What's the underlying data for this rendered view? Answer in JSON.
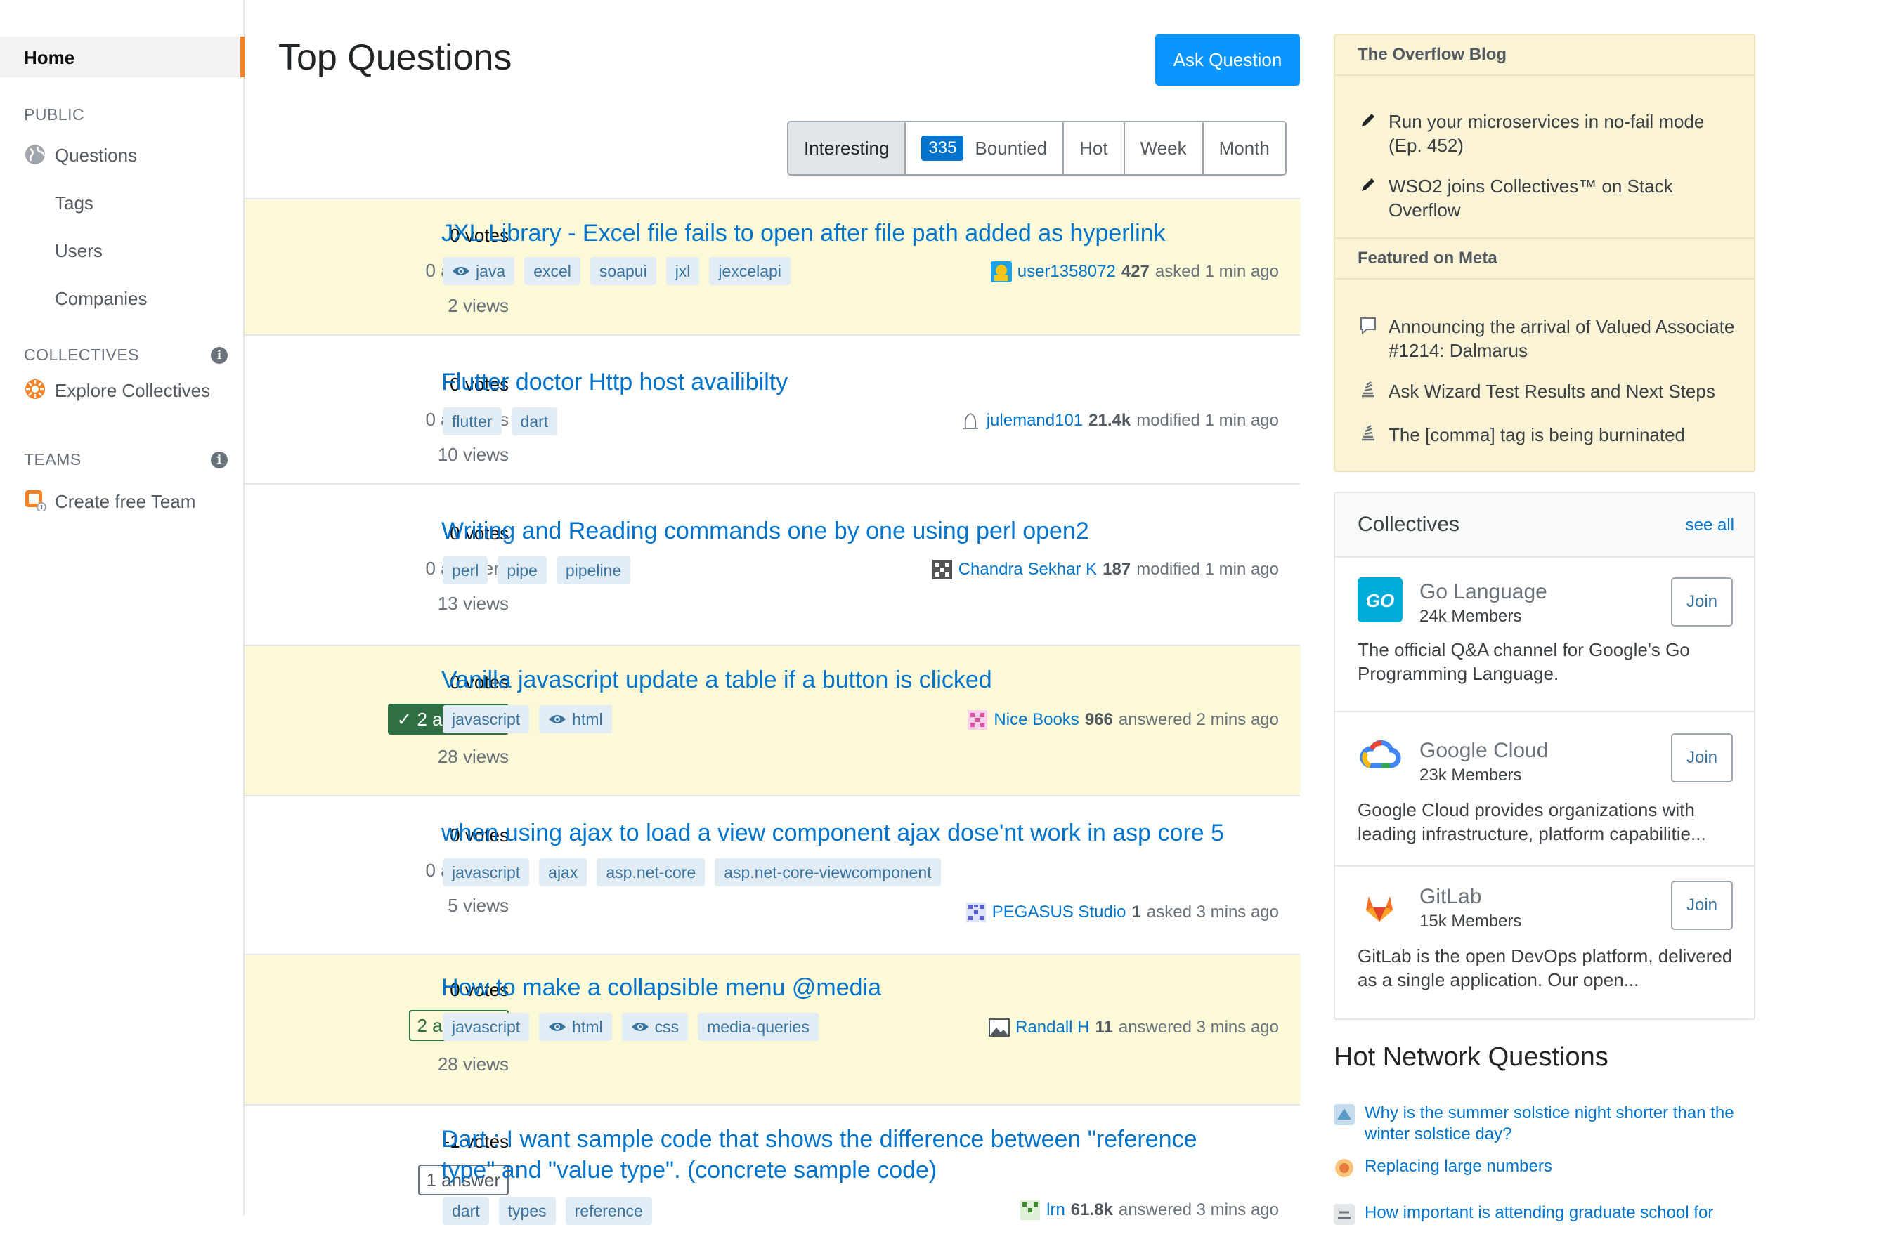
{
  "sidebar": {
    "home": "Home",
    "public": "PUBLIC",
    "questions": "Questions",
    "tags": "Tags",
    "users": "Users",
    "companies": "Companies",
    "collectives_head": "COLLECTIVES",
    "explore": "Explore Collectives",
    "teams_head": "TEAMS",
    "create_team": "Create free Team"
  },
  "header": {
    "title": "Top Questions",
    "ask": "Ask Question"
  },
  "filters": {
    "interesting": "Interesting",
    "bounty_count": "335",
    "bountied": "Bountied",
    "hot": "Hot",
    "week": "Week",
    "month": "Month"
  },
  "questions": [
    {
      "votes": "0 votes",
      "answers": "0 answers",
      "views": "2 views",
      "title": "JXL Library - Excel file fails to open after file path added as hyperlink",
      "tags": [
        "java",
        "excel",
        "soapui",
        "jxl",
        "jexcelapi"
      ],
      "user": "user1358072",
      "rep": "427",
      "action": "asked 1 min ago"
    },
    {
      "votes": "0 votes",
      "answers": "0 answers",
      "views": "10 views",
      "title": "Flutter doctor Http host availibilty",
      "tags": [
        "flutter",
        "dart"
      ],
      "user": "julemand101",
      "rep": "21.4k",
      "action": "modified 1 min ago"
    },
    {
      "votes": "0 votes",
      "answers": "0 answers",
      "views": "13 views",
      "title": "Writing and Reading commands one by one using perl open2",
      "tags": [
        "perl",
        "pipe",
        "pipeline"
      ],
      "user": "Chandra Sekhar K",
      "rep": "187",
      "action": "modified 1 min ago"
    },
    {
      "votes": "0 votes",
      "answers": "2 answers",
      "views": "28 views",
      "title": "Vanilla javascript update a table if a button is clicked",
      "tags": [
        "javascript",
        "html"
      ],
      "user": "Nice Books",
      "rep": "966",
      "action": "answered 2 mins ago"
    },
    {
      "votes": "0 votes",
      "answers": "0 answers",
      "views": "5 views",
      "title": "when using ajax to load a view component ajax dose'nt work in asp core 5",
      "tags": [
        "javascript",
        "ajax",
        "asp.net-core",
        "asp.net-core-viewcomponent"
      ],
      "user": "PEGASUS Studio",
      "rep": "1",
      "action": "asked 3 mins ago"
    },
    {
      "votes": "0 votes",
      "answers": "2 answers",
      "views": "28 views",
      "title": "How to make a collapsible menu @media",
      "tags": [
        "javascript",
        "html",
        "css",
        "media-queries"
      ],
      "user": "Randall H",
      "rep": "11",
      "action": "answered 3 mins ago"
    },
    {
      "votes": "-1 votes",
      "answers": "1 answer",
      "title_line1": "Dart : I want sample code that shows the difference between \"reference",
      "title_line2": "type\" and \"value type\". (concrete sample code)",
      "tags": [
        "dart",
        "types",
        "reference"
      ],
      "user": "lrn",
      "rep": "61.8k",
      "action": "answered 3 mins ago"
    }
  ],
  "blog": {
    "head": "The Overflow Blog",
    "item1": "Run your microservices in no-fail mode (Ep. 452)",
    "item2": "WSO2 joins Collectives™ on Stack Overflow",
    "meta_head": "Featured on Meta",
    "meta1": "Announcing the arrival of Valued Associate #1214: Dalmarus",
    "meta2": "Ask Wizard Test Results and Next Steps",
    "meta3": "The [comma] tag is being burninated"
  },
  "collectives": {
    "title": "Collectives",
    "see_all": "see all",
    "join": "Join",
    "items": [
      {
        "name": "Go Language",
        "members": "24k Members",
        "desc": "The official Q&A channel for Google's Go Programming Language.",
        "icon_text": "GO"
      },
      {
        "name": "Google Cloud",
        "members": "23k Members",
        "desc": "Google Cloud provides organizations with leading infrastructure, platform capabilitie..."
      },
      {
        "name": "GitLab",
        "members": "15k Members",
        "desc": "GitLab is the open DevOps platform, delivered as a single application. Our open..."
      }
    ]
  },
  "hot": {
    "title": "Hot Network Questions",
    "items": [
      "Why is the summer solstice night shorter than the winter solstice day?",
      "Replacing large numbers",
      "How important is attending graduate school for"
    ]
  },
  "colors": {
    "accent": "#f48225",
    "link": "#0074cc",
    "primary_button": "#0a95ff",
    "accepted": "#2f6f44",
    "tag_bg": "#e1ecf4",
    "highlight_row": "#fbf9d7"
  }
}
